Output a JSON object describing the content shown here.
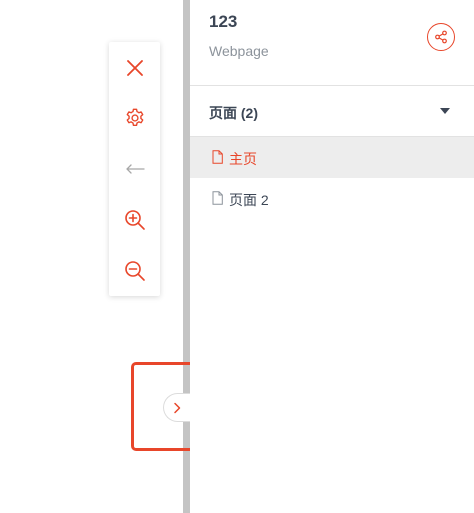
{
  "site": {
    "title": "123",
    "type": "Webpage"
  },
  "pages_section": {
    "label": "页面 (2)"
  },
  "pages": [
    {
      "label": "主页",
      "active": true
    },
    {
      "label": "页面 2",
      "active": false
    }
  ],
  "toolbar": {
    "items": [
      "close-icon",
      "gear-icon",
      "arrow-left-icon",
      "zoom-in-icon",
      "zoom-out-icon"
    ]
  },
  "icons": {
    "share": "share-icon",
    "expand": "chevron-right-icon",
    "page": "document-icon",
    "dropdown": "caret-down-icon"
  },
  "colors": {
    "accent": "#e8462a",
    "text": "#3c4655",
    "muted": "#8c939b",
    "disabled": "#a8a8a8",
    "divider": "#c4c4c4",
    "active_row": "#ededed"
  }
}
